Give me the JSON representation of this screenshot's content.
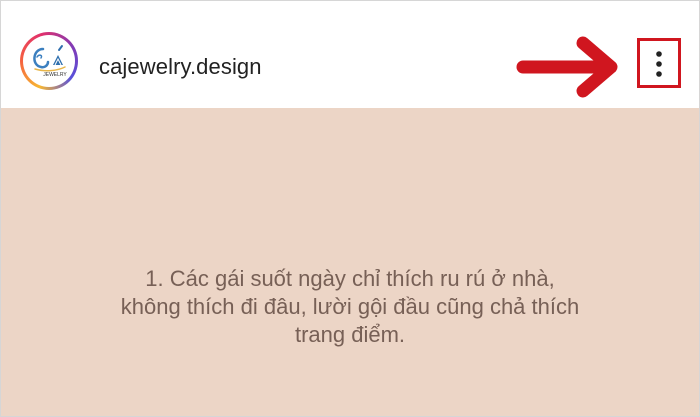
{
  "post_header": {
    "username": "cajewelry.design",
    "avatar_logo_text": "JEWELRY",
    "menu_icon": "more-vertical-icon",
    "pointer_icon": "red-right-arrow-icon"
  },
  "post": {
    "caption": "1. Các gái suốt ngày chỉ thích ru rú ở nhà, không thích đi đâu, lười gội đầu cũng chả thích trang điểm."
  },
  "colors": {
    "post_background": "#ecd5c6",
    "caption_text": "#776056",
    "highlight_red": "#d0161f"
  }
}
